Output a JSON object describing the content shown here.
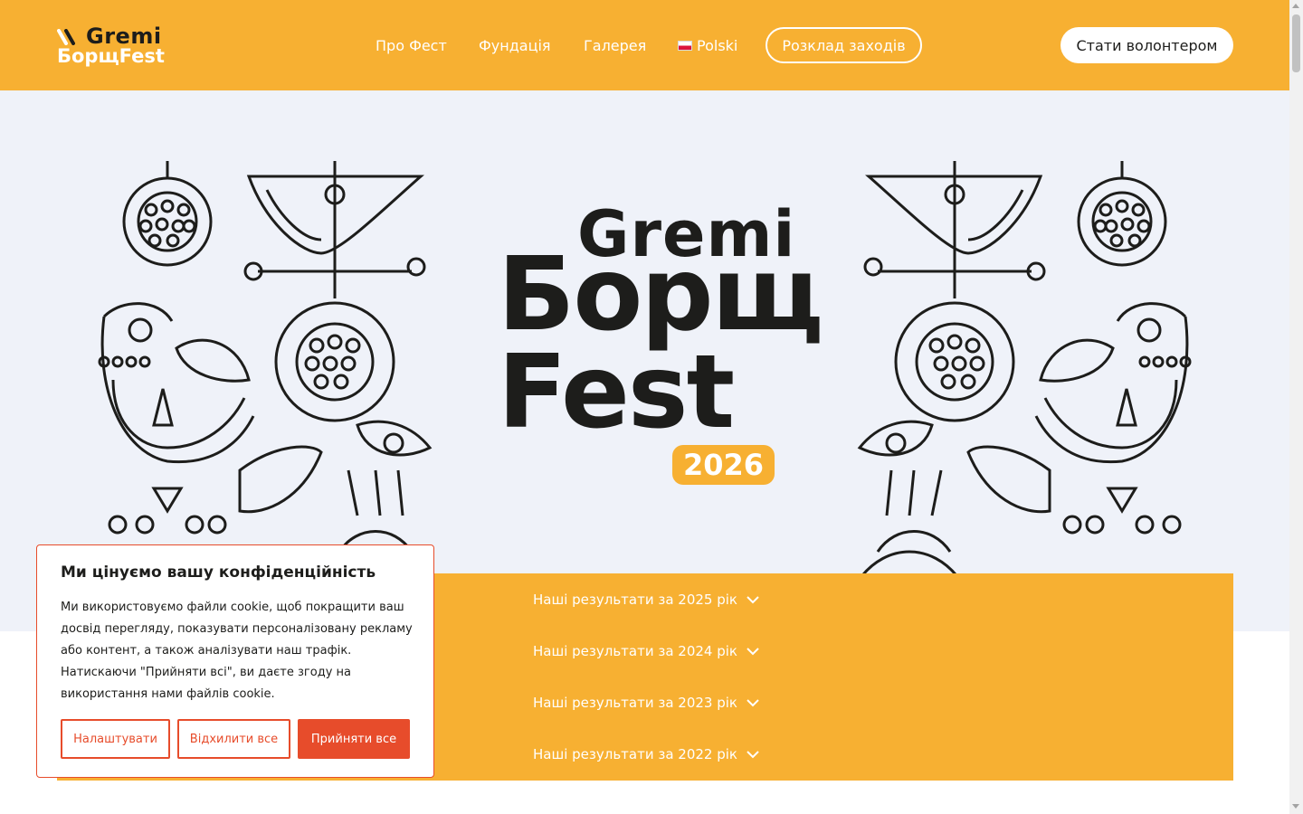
{
  "header": {
    "logo": {
      "line1": "Gremi",
      "line2": "БорщFest"
    },
    "nav": [
      "Про Фест",
      "Фундація",
      "Галерея"
    ],
    "language": {
      "label": "Polski"
    },
    "schedule_button": "Розклад заходів",
    "volunteer_button": "Стати волонтером"
  },
  "hero": {
    "logo": {
      "line1": "Gremi",
      "line2": "Борщ",
      "line3": "Fest",
      "year": "2026"
    }
  },
  "results": {
    "items": [
      {
        "label": "Наші результати за 2025 рік"
      },
      {
        "label": "Наші результати за 2024 рік"
      },
      {
        "label": "Наші результати за 2023 рік"
      },
      {
        "label": "Наші результати за 2022 рік"
      }
    ]
  },
  "cookie_banner": {
    "title": "Ми цінуємо вашу конфіденційність",
    "text": "Ми використовуємо файли cookie, щоб покращити ваш досвід перегляду, показувати персоналізовану рекламу або контент, а також аналізувати наш трафік. Натискаючи \"Прийняти всі\", ви даєте згоду на використання нами файлів cookie.",
    "customize": "Налаштувати",
    "reject": "Відхилити все",
    "accept": "Прийняти все"
  },
  "colors": {
    "accent": "#f7b032",
    "cookie_accent": "#e74c2b",
    "hero_bg": "#eff2f9",
    "text": "#1d1d1b"
  },
  "icons": [
    "logo-mark-icon",
    "poland-flag-icon",
    "chevron-down-icon",
    "folk-ornament-illustration"
  ]
}
